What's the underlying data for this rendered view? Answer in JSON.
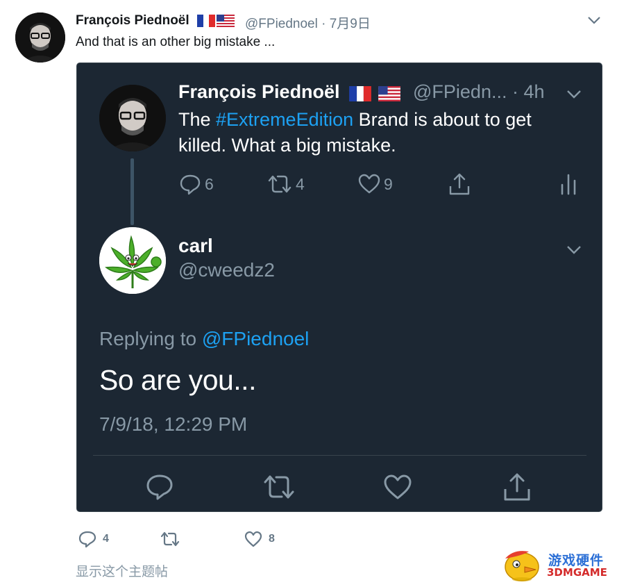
{
  "outer_tweet": {
    "author_name": "François Piednoël",
    "handle_date": "@FPiednoel · 7月9日",
    "text": "And that is an other big mistake ...",
    "actions": {
      "reply_count": "4",
      "retweet_count": "",
      "like_count": "8"
    },
    "show_thread": "显示这个主题帖"
  },
  "quoted_thread": {
    "parent": {
      "author_name": "François Piednoël",
      "handle_time": "@FPiedn...  · 4h",
      "text_before": "The ",
      "hashtag": "#ExtremeEdition",
      "text_after": " Brand is about to get killed. What a big mistake.",
      "reply_count": "6",
      "retweet_count": "4",
      "like_count": "9"
    },
    "reply": {
      "author_name": "carl",
      "handle": "@cweedz2",
      "replying_prefix": "Replying to ",
      "replying_mention": "@FPiednoel",
      "text": "So are you...",
      "timestamp": "7/9/18, 12:29 PM"
    }
  },
  "watermark": {
    "cn": "游戏硬件",
    "en": "3DMGAME"
  },
  "colors": {
    "card_bg": "#1c2733",
    "accent": "#1da1f2",
    "muted": "#8899a6",
    "outer_muted": "#657786"
  },
  "icons": [
    "reply-icon",
    "retweet-icon",
    "like-icon",
    "share-icon",
    "analytics-icon",
    "chevron-down-icon",
    "france-flag-icon",
    "us-flag-icon"
  ]
}
